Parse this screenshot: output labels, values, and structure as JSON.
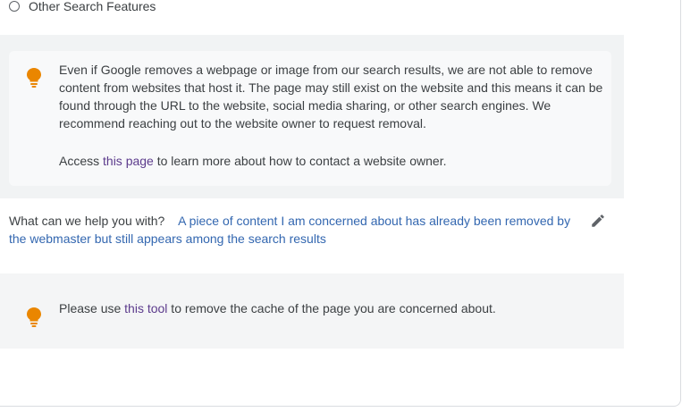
{
  "option": {
    "label": "Other Search Features"
  },
  "notice": {
    "body": "Even if Google removes a webpage or image from our search results, we are not able to remove content from websites that host it. The page may still exist on the website and this means it can be found through the URL to the website, social media sharing, or other search engines. We recommend reaching out to the website owner to request removal.",
    "access_prefix": "Access ",
    "access_link": "this page",
    "access_suffix": " to learn more about how to contact a website owner."
  },
  "question": {
    "prompt": "What can we help you with?",
    "answer": "A piece of content I am concerned about has already been removed by the webmaster but still appears among the search results"
  },
  "tool_notice": {
    "prefix": "Please use ",
    "link": "this tool",
    "suffix": " to remove the cache of the page you are concerned about."
  },
  "colors": {
    "bulb": "#ea8600",
    "link": "#5c3b8c",
    "answer": "#3367b0"
  }
}
